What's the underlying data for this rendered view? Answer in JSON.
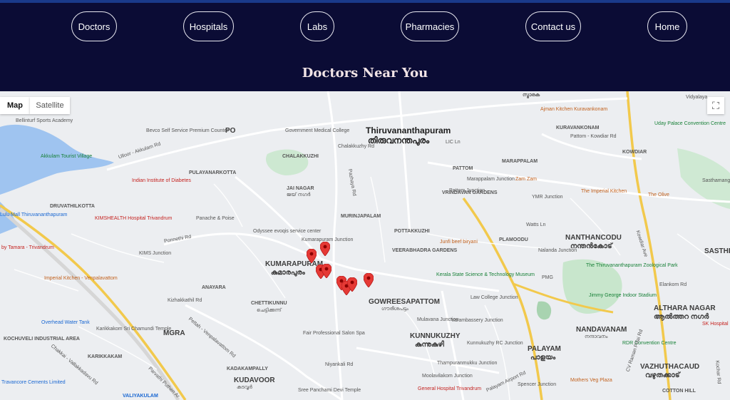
{
  "nav": {
    "doctors": "Doctors",
    "hospitals": "Hospitals",
    "labs": "Labs",
    "pharmacies": "Pharmacies",
    "contact": "Contact us",
    "home": "Home"
  },
  "page_title": "Doctors Near You",
  "map": {
    "map_button": "Map",
    "satellite_button": "Satellite",
    "city_en": "Thiruvananthapuram",
    "city_ml": "തിരുവനന്തപുരം",
    "labels": {
      "kumarapuram_en": "KUMARAPURAM",
      "kumarapuram_ml": "കുമാരപുരം",
      "jai_nagar_en": "JAI NAGAR",
      "jai_nagar_ml": "ജയ് നഗർ",
      "chettikunnu_en": "CHETTIKUNNU",
      "chettikunnu_ml": "ചെട്ടിക്കുന്ന്",
      "gowreesapattom_en": "GOWREESAPATTOM",
      "gowreesapattom_ml": "ഗൗരീശപട്ടം",
      "kunnukuzhy_en": "KUNNUKUZHY",
      "kunnukuzhy_ml": "കുന്നുകുഴി",
      "palayam_en": "PALAYAM",
      "palayam_ml": "പാളയം",
      "nandavanam_en": "NANDAVANAM",
      "nandavanam_ml": "നന്ദാവനം",
      "althara_en": "ALTHARA NAGAR",
      "althara_ml": "ആൽത്തറ നഗർ",
      "vazhuthacaud_en": "VAZHUTHACAUD",
      "vazhuthacaud_ml": "വഴുതക്കാട്",
      "nanthancodu_en": "NANTHANCODU",
      "nanthancodu_ml": "നന്തൻകോട്",
      "kudavoor_en": "KUDAVOOR",
      "kudavoor_ml": "കുടവൂർ",
      "mgra": "MGRA",
      "sasthi": "SASTHI",
      "chalakkuzhi": "CHALAKKUZHI",
      "anayara": "ANAYARA",
      "pulayanarkotta": "PULAYANARKOTTA",
      "druvathilkotta": "DRUVATHILKOTTA",
      "kochuveli": "KOCHUVELI INDUSTRIAL AREA",
      "karikkakam": "KARIKKAKAM",
      "kadakampally": "KADAKAMPALLY",
      "pattom": "PATTOM",
      "marappalam": "MARAPPALAM",
      "kuravankonam": "KURAVANKONAM",
      "kowdiar": "KOWDIAR",
      "potakuzhi": "POTTAKKUZHI",
      "veerabhadra": "VEERABHADRA GARDENS",
      "murinjapalam": "MURINJAPALAM",
      "vrindavan": "VRINDAVAN GARDENS",
      "plamoodu": "PLAMOODU",
      "valiyakulam": "VALIYAKULAM",
      "cotton_hill": "COTTON HILL",
      "smaraka": "സ്മാരക",
      "po": "PO"
    },
    "pois": {
      "akkulam": "Akkulam Tourist Village",
      "bellinturf": "Bellinturf Sports Academy",
      "indian_institute": "Indian Institute of Diabetes",
      "kimshealth": "KIMSHEALTH Hospital Trivandrum",
      "tamara": "by Tamara - Trivandrum",
      "lulu": "Lulu Mall Thiruvananthapuram",
      "imperial_venpalavattom": "Imperial Kitchen - Venpalavattom",
      "bevco": "Bevco Self Service Premium Counter",
      "govt_medical": "Government Medical College",
      "panache": "Panache & Poise",
      "odyssee": "Odyssee evoqis service center",
      "fair_professional": "Fair Professional Salon Spa",
      "karikkakom": "Karikkakom Sri Chamundi Temple",
      "overhead_tank": "Overhead Water Tank",
      "travancore": "Travancore Cements Limited",
      "sree_panchami": "Sree Panchami Devi Temple",
      "general_hospital": "General Hospital Trivandrum",
      "kerala_science": "Kerala State Science & Technology Museum",
      "junfi": "Junfi beef biryani",
      "zoological": "The Thiruvananthapuram Zoological Park",
      "jimmy_george": "Jimmy George Indoor Stadium",
      "rdr": "RDR Convention Centre",
      "mothers_veg": "Mothers Veg Plaza",
      "imperial_kitchen": "The Imperial Kitchen",
      "olive": "The Olive",
      "zam_zam": "Zam Zam",
      "ajman": "Ajman Kitchen Kuravankonam",
      "uday_palace": "Uday Palace Convention Centre",
      "sasthamangalam": "Sasthamangalam",
      "sk_hospital": "SK Hospital",
      "ymr": "YMR Junction",
      "pattom_junction": "Pattom Junction",
      "marappalam_junction": "Marappalam Junction",
      "kims_junction": "KIMS Junction",
      "law_college": "Law College Junction",
      "mulavana": "Mulavana Junction",
      "varambassery": "Varambassery Junction",
      "kunnukuzhy_junction": "Kunnukuzhy RC Junction",
      "thampuranmukku": "Thampuranmukku Junction",
      "moolavilakom": "Moolavilakom Junction",
      "spencer": "Spencer Junction",
      "nalanda": "Nalanda Junction",
      "kumarapuram_junction": "Kumarapuram Junction",
      "pmg": "PMG",
      "watts_ln": "Watts Ln",
      "lic_ln": "LIC Ln",
      "elankom": "Elankom Rd",
      "vidyalaya": "Vidyalaya"
    },
    "roads": {
      "ulloor_akkulam": "Ulloor - Akkulam Rd",
      "chalakkuzhy": "Chalakkuzhy Rd",
      "pazhaya_rd": "Pazhaya Rd",
      "kowdiar_ave": "Kowdiar Ave",
      "cv_raman": "CV Raman Pillai Rd",
      "pettah": "Pettah - Venpalavattom Rd",
      "chakkai": "Chakkai - Vallakkadavu Rd",
      "parvathi": "Parvathi Puthen Ar",
      "palayam_airport": "Palayam Airport Rd",
      "ponnethi": "Ponnethi Rd",
      "kizhakkathil": "Kizhakkathil Rd",
      "niyankali": "Niyankali Rd",
      "kochar": "Kochar Rd",
      "pattom_kowdiar": "Pattom - Kowdiar Rd"
    }
  }
}
